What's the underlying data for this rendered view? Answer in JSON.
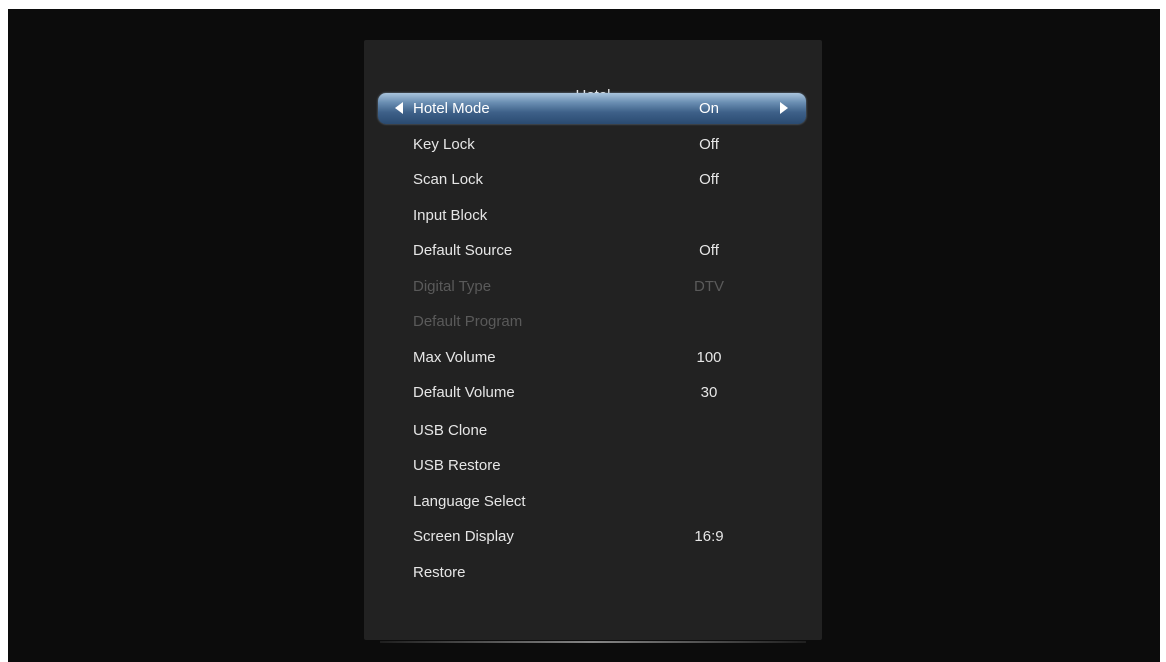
{
  "menu": {
    "title": "Hotel",
    "items": [
      {
        "label": "Hotel Mode",
        "value": "On",
        "state": "selected"
      },
      {
        "label": "Key Lock",
        "value": "Off",
        "state": "normal"
      },
      {
        "label": "Scan Lock",
        "value": "Off",
        "state": "normal"
      },
      {
        "label": "Input Block",
        "value": "",
        "state": "normal"
      },
      {
        "label": "Default Source",
        "value": "Off",
        "state": "normal"
      },
      {
        "label": "Digital Type",
        "value": "DTV",
        "state": "disabled"
      },
      {
        "label": "Default Program",
        "value": "",
        "state": "disabled"
      },
      {
        "label": "Max Volume",
        "value": "100",
        "state": "normal"
      },
      {
        "label": "Default Volume",
        "value": "30",
        "state": "normal"
      },
      {
        "label": "USB Clone",
        "value": "",
        "state": "normal"
      },
      {
        "label": "USB Restore",
        "value": "",
        "state": "normal"
      },
      {
        "label": "Language Select",
        "value": "",
        "state": "normal"
      },
      {
        "label": "Screen Display",
        "value": "16:9",
        "state": "normal"
      },
      {
        "label": "Restore",
        "value": "",
        "state": "normal"
      }
    ]
  },
  "icons": {
    "left_arrow": "triangle-left-icon",
    "right_arrow": "triangle-right-icon"
  },
  "colors": {
    "background": "#0c0c0c",
    "panel": "#222222",
    "highlight": "#3e6189",
    "text": "#e6e6e6",
    "disabled_text": "#5a5a5a"
  }
}
